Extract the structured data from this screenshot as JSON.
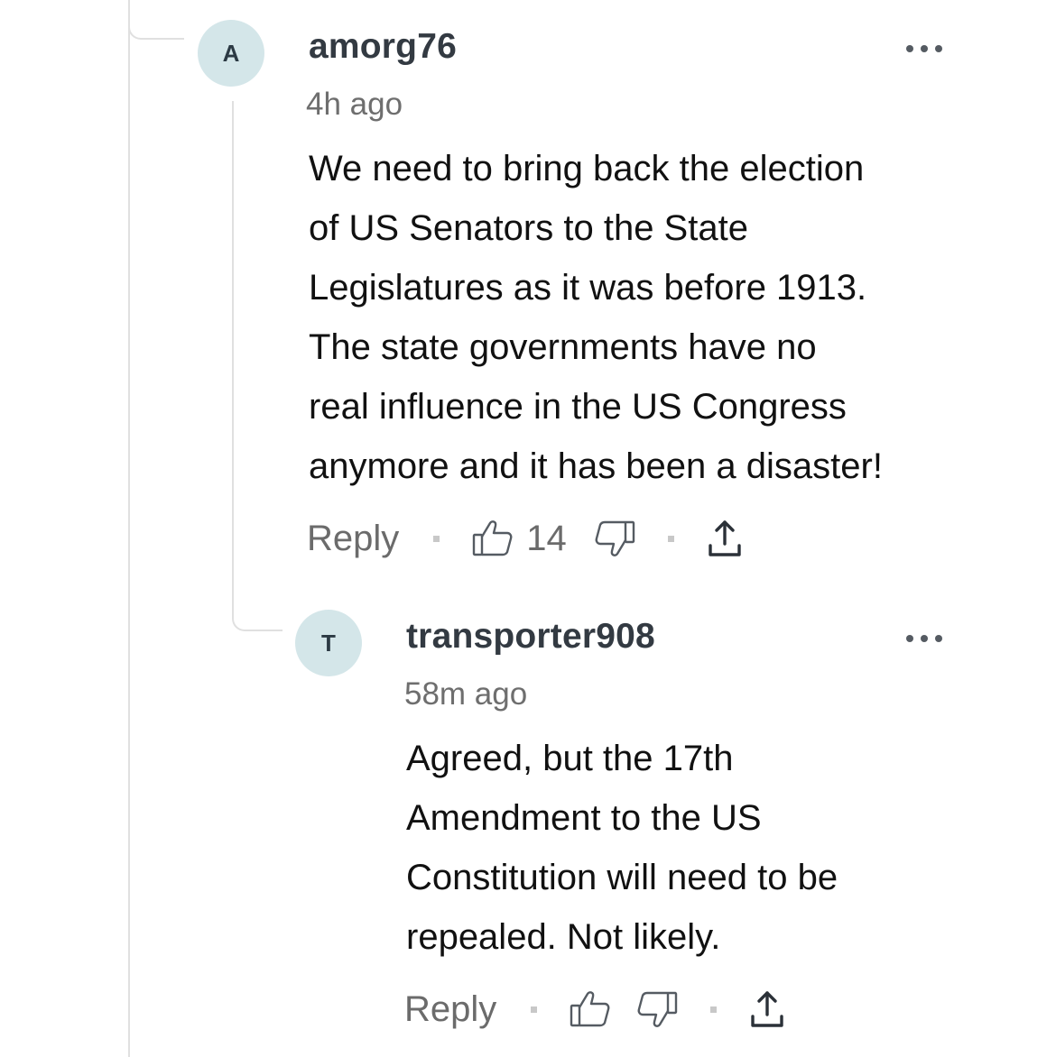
{
  "comments": [
    {
      "avatar_letter": "A",
      "username": "amorg76",
      "timestamp": "4h ago",
      "body": "We need to bring back the election\nof US Senators to the State\nLegislatures as it was before 1913.\nThe state governments have no\nreal influence in the US Congress\nanymore and it has been a disaster!",
      "reply_label": "Reply",
      "like_count": "14"
    },
    {
      "avatar_letter": "T",
      "username": "transporter908",
      "timestamp": "58m ago",
      "body": "Agreed, but the 17th\nAmendment to the US\nConstitution will need to be\nrepealed.  Not likely.",
      "reply_label": "Reply",
      "like_count": ""
    }
  ],
  "icons": {
    "more": "more-options-icon",
    "like": "thumbs-up-icon",
    "dislike": "thumbs-down-icon",
    "share": "share-icon"
  },
  "colors": {
    "avatar_bg": "#d4e6e9",
    "username": "#333a42",
    "meta": "#6e6e6e",
    "thread_line": "#e0e0e0"
  }
}
